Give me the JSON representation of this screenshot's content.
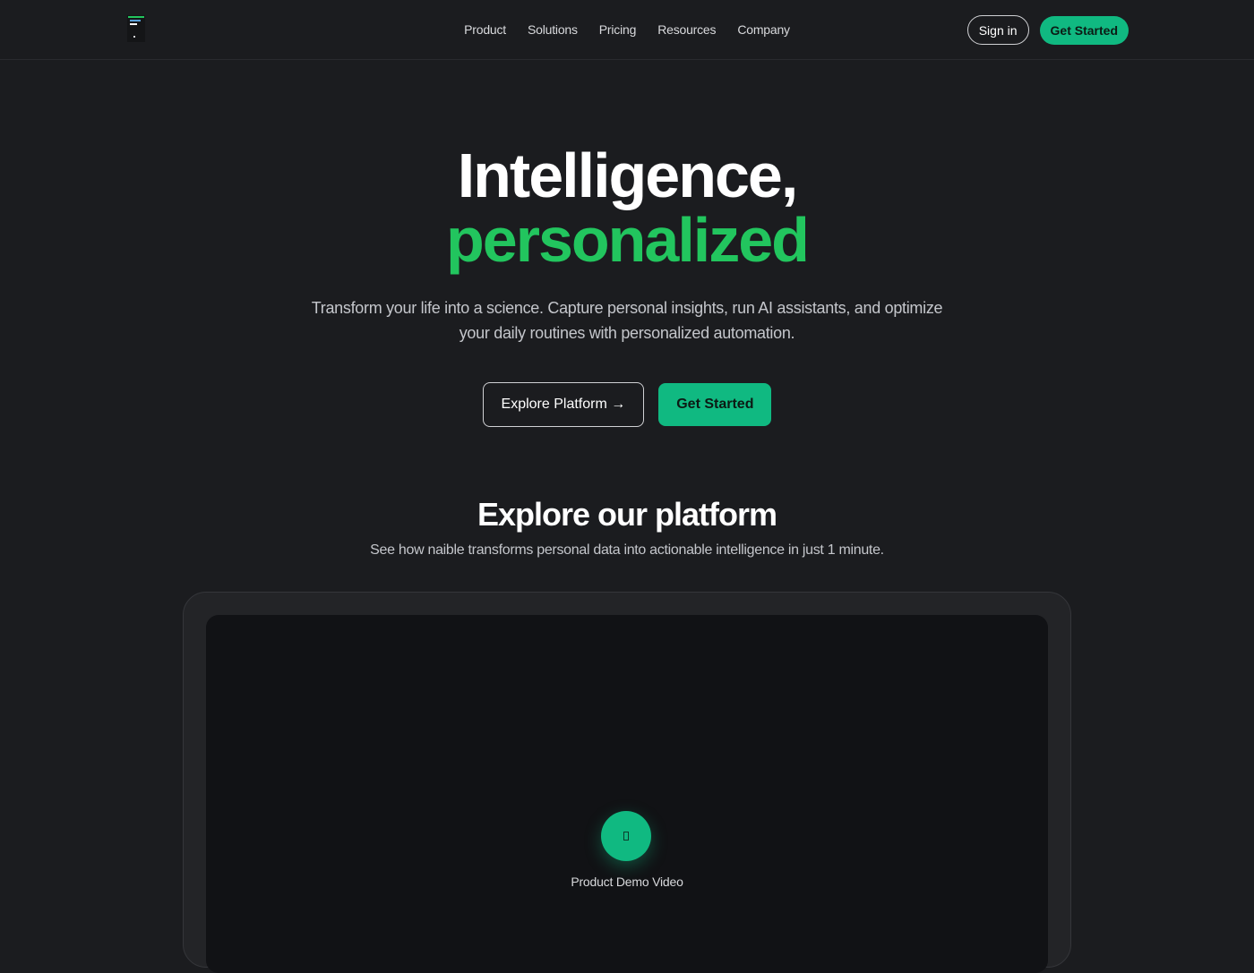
{
  "colors": {
    "background": "#1b1c1f",
    "accent": "#10b981",
    "headline_accent": "#22c55e"
  },
  "header": {
    "logo_icon": "brand-logo-icon",
    "nav": [
      {
        "label": "Product"
      },
      {
        "label": "Solutions"
      },
      {
        "label": "Pricing"
      },
      {
        "label": "Resources"
      },
      {
        "label": "Company"
      }
    ],
    "signin_label": "Sign in",
    "get_started_label": "Get Started"
  },
  "hero": {
    "title_line1": "Intelligence,",
    "title_line2": "personalized",
    "subtitle": "Transform your life into a science. Capture personal insights, run AI assistants, and optimize your daily routines with personalized automation.",
    "explore_label": "Explore Platform →",
    "get_started_label": "Get Started"
  },
  "platform": {
    "title": "Explore our platform",
    "subtitle": "See how naible transforms personal data into actionable intelligence in just 1 minute.",
    "video_label": "Product Demo Video",
    "play_icon": "play-icon"
  }
}
